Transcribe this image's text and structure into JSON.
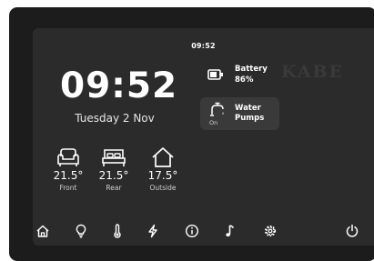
{
  "status_bar": {
    "time": "09:52"
  },
  "clock": {
    "time": "09:52",
    "date": "Tuesday 2 Nov"
  },
  "battery": {
    "label_line1": "Battery",
    "label_line2": "86%",
    "icon": "battery-icon"
  },
  "brand": {
    "logo_text": "KABE"
  },
  "water_pumps": {
    "state": "On",
    "label_line1": "Water",
    "label_line2": "Pumps",
    "icon": "tap-icon"
  },
  "temperatures": [
    {
      "value": "21.5°",
      "label": "Front",
      "icon": "sofa-icon"
    },
    {
      "value": "21.5°",
      "label": "Rear",
      "icon": "bed-icon"
    },
    {
      "value": "17.5°",
      "label": "Outside",
      "icon": "house-icon"
    }
  ],
  "navbar": {
    "items": [
      "home",
      "light",
      "temperature",
      "power",
      "info",
      "music",
      "settings",
      "shutdown"
    ]
  },
  "colors": {
    "screen": "#2b2b2b",
    "bezel": "#1c1c1c",
    "tile": "#3a3a3a",
    "text": "#ffffff"
  }
}
